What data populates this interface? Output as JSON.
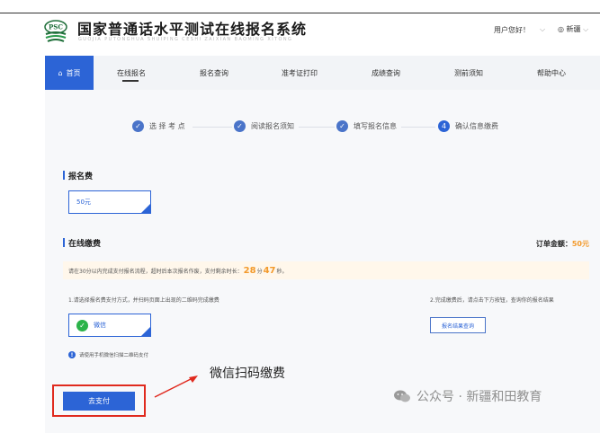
{
  "header": {
    "logo_text": "PSC",
    "title": "国家普通话水平测试在线报名系统",
    "subtitle": "GUOJIA PUTONGHUA SHUIPING CESHI ZAIXIAN BAOMING XITONG",
    "greeting": "用户您好！",
    "region": "新疆"
  },
  "nav": {
    "home": "首页",
    "items": [
      "在线报名",
      "报名查询",
      "准考证打印",
      "成绩查询",
      "测前须知",
      "帮助中心"
    ]
  },
  "steps": [
    "选 择 考 点",
    "阅读报名须知",
    "填写报名信息",
    "确认信息缴费"
  ],
  "step_active_number": "4",
  "fee": {
    "section_title": "报名费",
    "amount": "50元"
  },
  "payment": {
    "section_title": "在线缴费",
    "order_label": "订单金额：",
    "order_amount": "50元",
    "tip_prefix": "请在30分以内完成支付报名流程，超时后本次报名作废，支付剩余时长：",
    "minutes": "28",
    "minutes_unit": "分",
    "seconds": "47",
    "seconds_unit": "秒。",
    "note_left": "1.请选择报名费支付方式，并扫码页面上出现的二维码完成缴费",
    "note_right": "2.完成缴费后，请点击下方按钮，查询你的报名结果",
    "wechat_label": "微信",
    "query_button": "报名结果查询",
    "info_text": "请使用手机微信扫描二维码支付",
    "pay_button": "去支付"
  },
  "annotation": "微信扫码缴费",
  "watermark": "公众号 · 新疆和田教育",
  "colors": {
    "primary": "#2c64d6",
    "accent": "#f39a2b",
    "highlight": "#e02a1e",
    "wechat": "#2cb34a"
  }
}
